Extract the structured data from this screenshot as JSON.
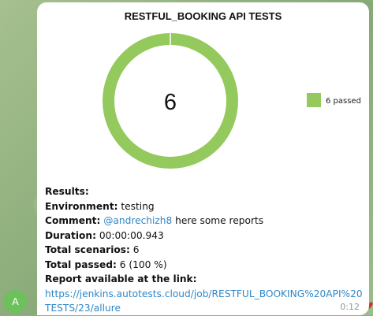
{
  "message": {
    "sender_initial": "A",
    "time": "0:12",
    "report_title": "RESTFUL_BOOKING API TESTS",
    "chart_data": {
      "type": "pie",
      "title": "RESTFUL_BOOKING API TESTS",
      "center_label": "6",
      "slices": [
        {
          "name": "6 passed",
          "value": 6,
          "color": "#94c95d"
        }
      ],
      "legend": "right"
    },
    "results_heading": "Results:",
    "environment_label": "Environment:",
    "environment_value": "testing",
    "comment_label": "Comment:",
    "comment_mention": "@andrechizh8",
    "comment_text": "here some reports",
    "duration_label": "Duration:",
    "duration_value": "00:00:00.943",
    "total_scenarios_label": "Total scenarios:",
    "total_scenarios_value": "6",
    "total_passed_label": "Total passed:",
    "total_passed_value": "6 (100 %)",
    "report_label": "Report available at the link:",
    "report_url_line1": "https://jenkins.autotests.cloud/job/RESTFUL_BOOKING%20API%20",
    "report_url_line2": "TESTS/23/allure"
  },
  "colors": {
    "passed": "#94c95d",
    "link": "#2f88c7",
    "avatar": "#6cc15b"
  }
}
